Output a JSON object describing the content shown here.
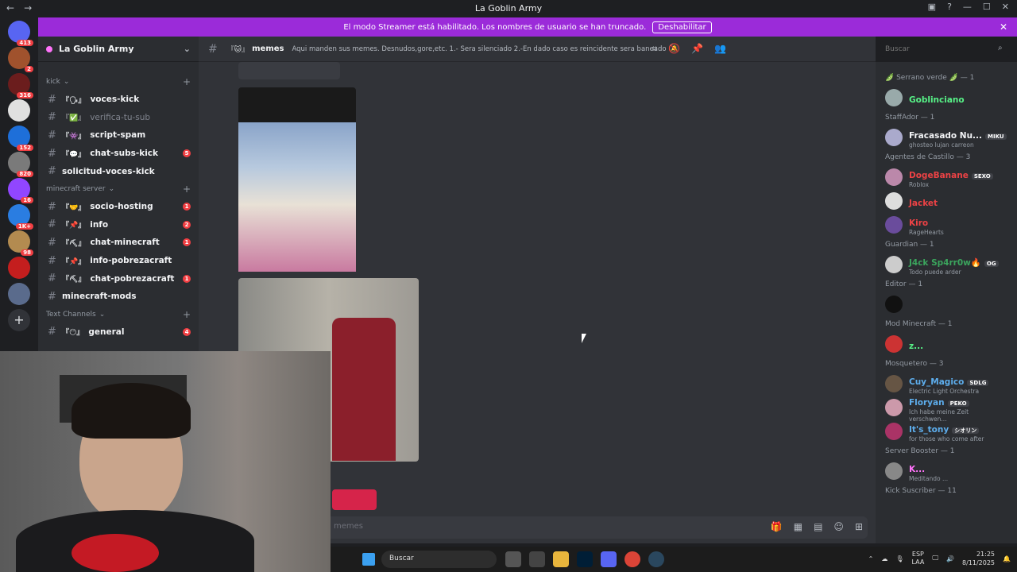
{
  "window": {
    "title": "La Goblin Army"
  },
  "banner": {
    "text": "El modo Streamer está habilitado. Los nombres de usuario se han truncado.",
    "button": "Deshabilitar"
  },
  "servers": [
    {
      "badge": "413",
      "color": "#5865f2"
    },
    {
      "badge": "2",
      "color": "#a0522d"
    },
    {
      "badge": "316",
      "color": "#6b1d1d"
    },
    {
      "badge": "",
      "color": "#e0e0e0"
    },
    {
      "badge": "152",
      "color": "#1e6fd9"
    },
    {
      "badge": "820",
      "color": "#7a7a7a"
    },
    {
      "badge": "16",
      "color": "#9146ff"
    },
    {
      "badge": "1K+",
      "color": "#2a7de1"
    },
    {
      "badge": "98",
      "color": "#b38b50"
    },
    {
      "badge": "",
      "color": "#c41e1e"
    },
    {
      "badge": "",
      "color": "#5a6b8c"
    }
  ],
  "guild": {
    "name": "La Goblin Army"
  },
  "categories": [
    {
      "name": "kick",
      "channels": [
        {
          "deco": "『🗣』",
          "name": "voces-kick",
          "count": "",
          "muted": false
        },
        {
          "deco": "『✅』",
          "name": "verifica-tu-sub",
          "count": "",
          "muted": true
        },
        {
          "deco": "『👾』",
          "name": "script-spam",
          "count": "",
          "muted": false
        },
        {
          "deco": "『💬』",
          "name": "chat-subs-kick",
          "count": "5",
          "muted": false
        },
        {
          "deco": "",
          "name": "solicitud-voces-kick",
          "count": "",
          "muted": false
        }
      ]
    },
    {
      "name": "minecraft server",
      "channels": [
        {
          "deco": "『🤝』",
          "name": "socio-hosting",
          "count": "1",
          "muted": false
        },
        {
          "deco": "『📌』",
          "name": "info",
          "count": "2",
          "muted": false
        },
        {
          "deco": "『⛏』",
          "name": "chat-minecraft",
          "count": "1",
          "muted": false
        },
        {
          "deco": "『📌』",
          "name": "info-pobrezacraft",
          "count": "",
          "muted": false
        },
        {
          "deco": "『⛏』",
          "name": "chat-pobrezacraft",
          "count": "1",
          "muted": false
        },
        {
          "deco": "",
          "name": "minecraft-mods",
          "count": "",
          "muted": false
        }
      ]
    },
    {
      "name": "Text Channels",
      "channels": [
        {
          "deco": "『😶』",
          "name": "general",
          "count": "4",
          "muted": false
        }
      ]
    }
  ],
  "channel": {
    "deco": "『🐱』",
    "name": "memes",
    "topic": "Aqui manden sus memes. Desnudos,gore,etc. 1.- Sera silenciado 2.-En dado caso es reincidente sera baneado"
  },
  "search": {
    "placeholder": "Buscar"
  },
  "composer": {
    "placeholder": "memes"
  },
  "member_groups": [
    {
      "title": "🫛 Serrano verde 🫛 — 1",
      "members": [
        {
          "name": "Goblinciano",
          "sub": "",
          "tag": "",
          "color": "#57f287",
          "av": "#9aa"
        }
      ]
    },
    {
      "title": "StaffAdor — 1",
      "members": [
        {
          "name": "Fracasado Nu...",
          "sub": "ghosteo lujan carreon",
          "tag": "MIKU",
          "color": "#f2f3f5",
          "av": "#aac"
        }
      ]
    },
    {
      "title": "Agentes de Castillo — 3",
      "members": [
        {
          "name": "DogeBanane",
          "sub": "Roblox",
          "tag": "SEXO",
          "color": "#ed4245",
          "av": "#b8a"
        },
        {
          "name": "Jacket",
          "sub": "",
          "tag": "",
          "color": "#ed4245",
          "av": "#ddd"
        },
        {
          "name": "Kiro",
          "sub": "RageHearts",
          "tag": "",
          "color": "#ed4245",
          "av": "#6a4c9c"
        }
      ]
    },
    {
      "title": "Guardian — 1",
      "members": [
        {
          "name": "J4ck Sp4rr0w🔥",
          "sub": "Todo puede arder",
          "tag": "OG",
          "color": "#3ba55d",
          "av": "#ccc"
        }
      ]
    },
    {
      "title": "Editor — 1",
      "members": [
        {
          "name": "",
          "sub": "",
          "tag": "",
          "color": "#f2f3f5",
          "av": "#111"
        }
      ]
    },
    {
      "title": "Mod Minecraft — 1",
      "members": [
        {
          "name": "z...",
          "sub": "",
          "tag": "",
          "color": "#57f287",
          "av": "#c33"
        }
      ]
    },
    {
      "title": "Mosquetero — 3",
      "members": [
        {
          "name": "Cuy_Magico",
          "sub": "Electric Light Orchestra",
          "tag": "SDLG",
          "color": "#5dadec",
          "av": "#654"
        },
        {
          "name": "Floryan",
          "sub": "Ich habe meine Zeit verschwen...",
          "tag": "PEKO",
          "color": "#5dadec",
          "av": "#c9a"
        },
        {
          "name": "It's_tony",
          "sub": "for those who come after",
          "tag": "シオリン",
          "color": "#5dadec",
          "av": "#a36"
        }
      ]
    },
    {
      "title": "Server Booster — 1",
      "members": [
        {
          "name": "K...",
          "sub": "Meditando ...",
          "tag": "",
          "color": "#ff73fa",
          "av": "#888"
        }
      ]
    },
    {
      "title": "Kick Suscriber — 11",
      "members": []
    }
  ],
  "taskbar": {
    "search": "Buscar",
    "lang1": "ESP",
    "lang2": "LAA",
    "time": "21:25",
    "date": "8/11/2025"
  },
  "colors": {
    "accent": "#9b2bd9",
    "bg": "#313338",
    "sidebar": "#2b2d31"
  }
}
